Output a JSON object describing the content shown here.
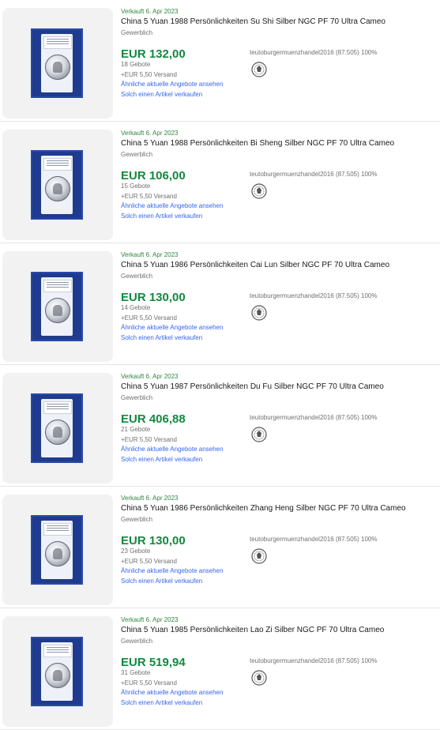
{
  "listings": [
    {
      "sold_date": "Verkauft 6. Apr 2023",
      "title": "China 5 Yuan 1988 Persönlichkeiten Su Shi Silber NGC PF 70 Ultra Cameo",
      "condition": "Gewerblich",
      "price": "EUR 132,00",
      "bids": "18 Gebote",
      "shipping": "+EUR 5,50 Versand",
      "similar_link": "Ähnliche aktuelle Angebote ansehen",
      "sell_link": "Solch einen Artikel verkaufen",
      "seller": "teutoburgermuenzhandel2016 (87.505) 100%"
    },
    {
      "sold_date": "Verkauft 6. Apr 2023",
      "title": "China 5 Yuan 1988 Persönlichkeiten Bi Sheng Silber NGC PF 70 Ultra Cameo",
      "condition": "Gewerblich",
      "price": "EUR 106,00",
      "bids": "15 Gebote",
      "shipping": "+EUR 5,50 Versand",
      "similar_link": "Ähnliche aktuelle Angebote ansehen",
      "sell_link": "Solch einen Artikel verkaufen",
      "seller": "teutoburgermuenzhandel2016 (87.505) 100%"
    },
    {
      "sold_date": "Verkauft 6. Apr 2023",
      "title": "China 5 Yuan 1986 Persönlichkeiten Cai Lun Silber NGC PF 70 Ultra Cameo",
      "condition": "Gewerblich",
      "price": "EUR 130,00",
      "bids": "14 Gebote",
      "shipping": "+EUR 5,50 Versand",
      "similar_link": "Ähnliche aktuelle Angebote ansehen",
      "sell_link": "Solch einen Artikel verkaufen",
      "seller": "teutoburgermuenzhandel2016 (87.505) 100%"
    },
    {
      "sold_date": "Verkauft 6. Apr 2023",
      "title": "China 5 Yuan 1987 Persönlichkeiten Du Fu Silber NGC PF 70 Ultra Cameo",
      "condition": "Gewerblich",
      "price": "EUR 406,88",
      "bids": "21 Gebote",
      "shipping": "+EUR 5,50 Versand",
      "similar_link": "Ähnliche aktuelle Angebote ansehen",
      "sell_link": "Solch einen Artikel verkaufen",
      "seller": "teutoburgermuenzhandel2016 (87.505) 100%"
    },
    {
      "sold_date": "Verkauft 6. Apr 2023",
      "title": "China 5 Yuan 1986 Persönlichkeiten Zhang Heng Silber NGC PF 70 Ultra Cameo",
      "condition": "Gewerblich",
      "price": "EUR 130,00",
      "bids": "23 Gebote",
      "shipping": "+EUR 5,50 Versand",
      "similar_link": "Ähnliche aktuelle Angebote ansehen",
      "sell_link": "Solch einen Artikel verkaufen",
      "seller": "teutoburgermuenzhandel2016 (87.505) 100%"
    },
    {
      "sold_date": "Verkauft 6. Apr 2023",
      "title": "China 5 Yuan 1985 Persönlichkeiten Lao Zi Silber NGC PF 70 Ultra Cameo",
      "condition": "Gewerblich",
      "price": "EUR 519,94",
      "bids": "31 Gebote",
      "shipping": "+EUR 5,50 Versand",
      "similar_link": "Ähnliche aktuelle Angebote ansehen",
      "sell_link": "Solch einen Artikel verkaufen",
      "seller": "teutoburgermuenzhandel2016 (87.505) 100%"
    }
  ],
  "colors": {
    "sold": "#2e8540",
    "price": "#118a3e",
    "link": "#3665f3",
    "slab": "#1f3b8f"
  }
}
